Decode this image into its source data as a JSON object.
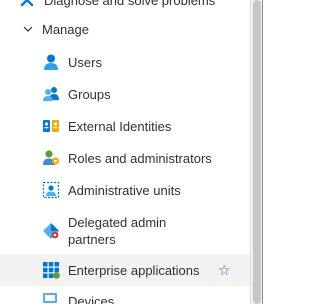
{
  "nav": {
    "top_item": {
      "label": "Diagnose and solve problems",
      "icon": "wrench-icon"
    },
    "group": {
      "label": "Manage",
      "expanded": true,
      "icon": "chevron-down-icon"
    },
    "items": [
      {
        "label": "Users",
        "icon": "user-icon"
      },
      {
        "label": "Groups",
        "icon": "groups-icon"
      },
      {
        "label": "External Identities",
        "icon": "external-identities-icon"
      },
      {
        "label": "Roles and administrators",
        "icon": "roles-icon"
      },
      {
        "label": "Administrative units",
        "icon": "administrative-units-icon"
      },
      {
        "label": "Delegated admin partners",
        "icon": "delegated-admin-icon"
      },
      {
        "label": "Enterprise applications",
        "icon": "enterprise-apps-icon",
        "selected": true,
        "favorite_icon": "star-outline-icon"
      },
      {
        "label": "Devices",
        "icon": "devices-icon"
      }
    ]
  },
  "colors": {
    "accent": "#0078d4",
    "selected_background": "#f3f2f1",
    "text": "#323130"
  }
}
